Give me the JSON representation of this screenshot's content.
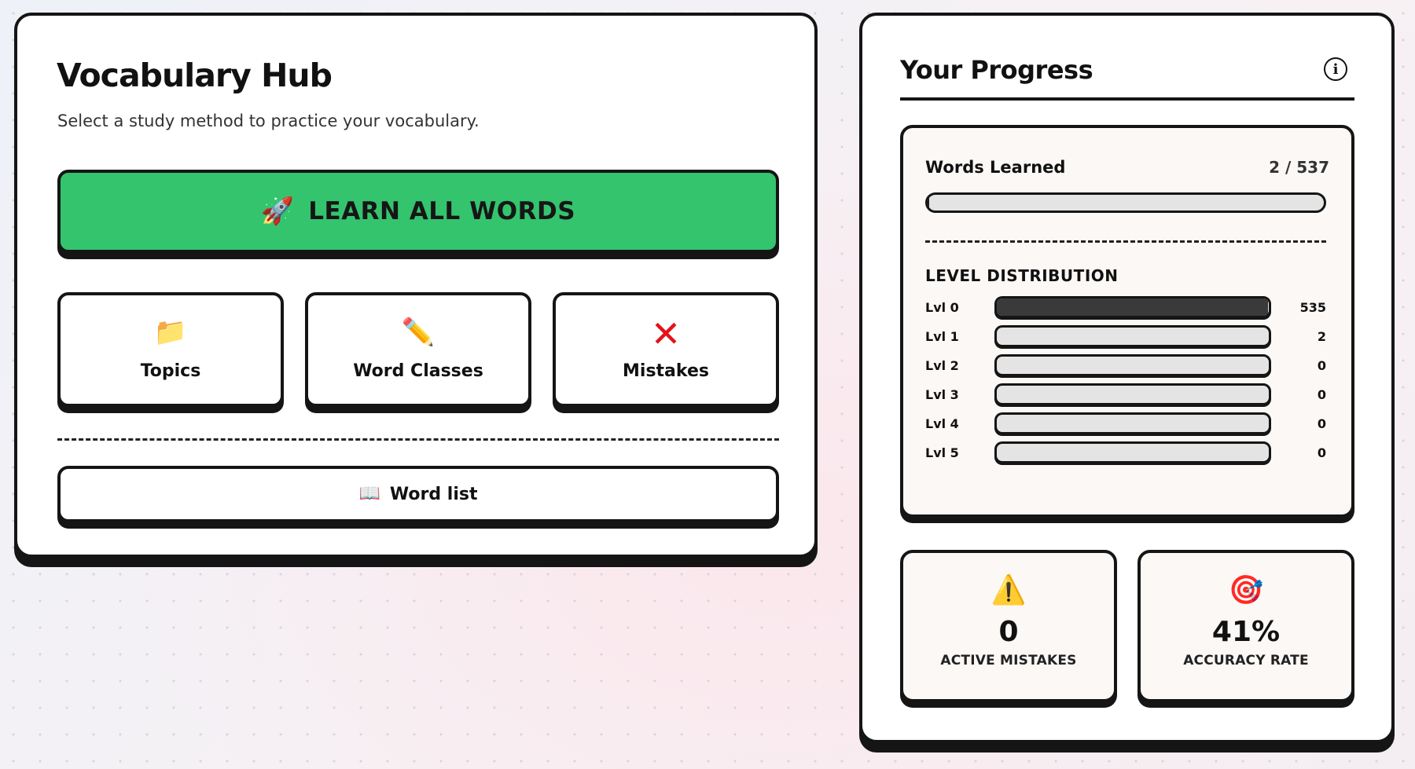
{
  "hub": {
    "title": "Vocabulary Hub",
    "subtitle": "Select a study method to practice your vocabulary.",
    "learn_all": {
      "icon": "rocket-icon",
      "emoji": "🚀",
      "label": "LEARN ALL WORDS",
      "color": "#34c46e"
    },
    "tiles": [
      {
        "icon": "folder-icon",
        "emoji": "📁",
        "label": "Topics"
      },
      {
        "icon": "pencil-icon",
        "emoji": "✏️",
        "label": "Word Classes"
      },
      {
        "icon": "red-x-icon",
        "emoji": "✕",
        "label": "Mistakes",
        "color": "#e3121c"
      }
    ],
    "word_list": {
      "icon": "book-icon",
      "emoji": "📖",
      "label": "Word list"
    }
  },
  "progress": {
    "title": "Your Progress",
    "info_icon": "i",
    "words_learned": {
      "label": "Words Learned",
      "count": "2 / 537",
      "learned": 2,
      "total": 537
    },
    "level_distribution": {
      "title": "LEVEL DISTRIBUTION",
      "levels": [
        {
          "name": "Lvl 0",
          "count": "535",
          "value": 535
        },
        {
          "name": "Lvl 1",
          "count": "2",
          "value": 2
        },
        {
          "name": "Lvl 2",
          "count": "0",
          "value": 0
        },
        {
          "name": "Lvl 3",
          "count": "0",
          "value": 0
        },
        {
          "name": "Lvl 4",
          "count": "0",
          "value": 0
        },
        {
          "name": "Lvl 5",
          "count": "0",
          "value": 0
        }
      ],
      "total": 537
    },
    "active_mistakes": {
      "icon": "warning-icon",
      "emoji": "⚠️",
      "value": "0",
      "label": "ACTIVE MISTAKES"
    },
    "accuracy": {
      "icon": "target-icon",
      "emoji": "🎯",
      "value": "41%",
      "label": "ACCURACY RATE"
    }
  }
}
